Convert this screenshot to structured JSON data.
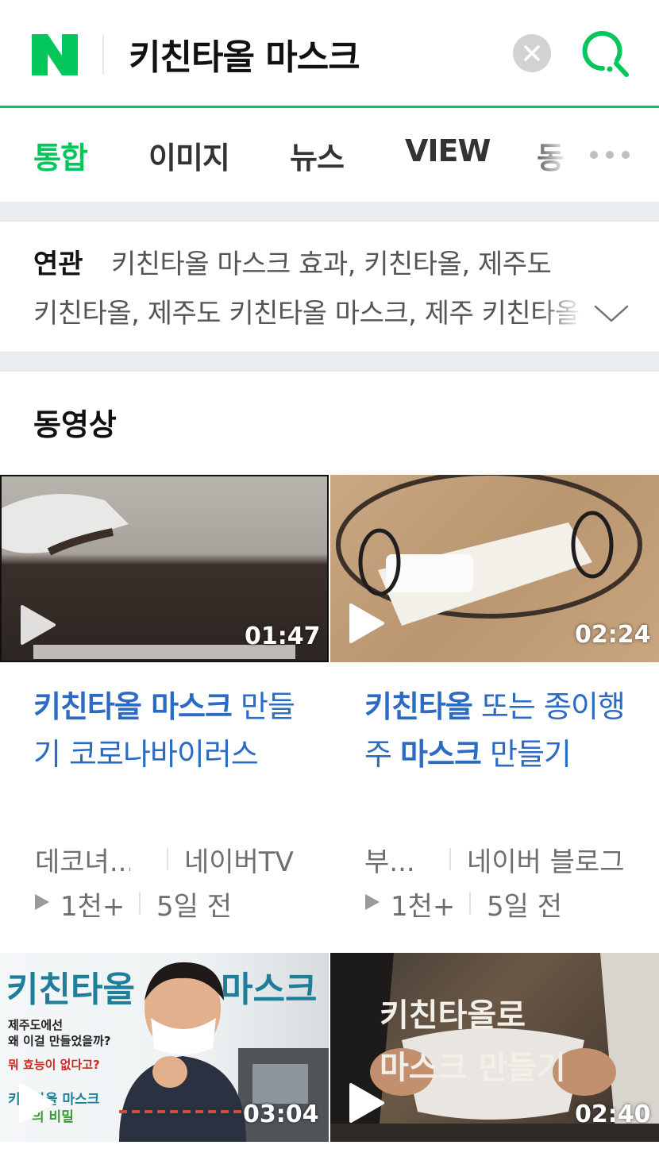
{
  "search": {
    "query": "키친타올 마스크"
  },
  "tabs": [
    {
      "label": "통합",
      "active": true
    },
    {
      "label": "이미지",
      "active": false
    },
    {
      "label": "뉴스",
      "active": false
    },
    {
      "label": "VIEW",
      "active": false
    },
    {
      "label": "동",
      "active": false
    }
  ],
  "related": {
    "label": "연관",
    "line1": "키친타올 마스크 효과, 키친타올, 제주도",
    "line2": "키친타올, 제주도 키친타올 마스크, 제주 키친타올"
  },
  "video_section": {
    "title": "동영상",
    "videos": [
      {
        "duration": "01:47",
        "title_parts": [
          {
            "text": "키친타올 마스크",
            "bold": true
          },
          {
            "text": " 만들기 코로나바이러스",
            "bold": false
          }
        ],
        "author": "데코녀...",
        "source": "네이버TV",
        "views": "1천+",
        "date": "5일 전"
      },
      {
        "duration": "02:24",
        "title_parts": [
          {
            "text": "키친타올",
            "bold": true
          },
          {
            "text": " 또는 종이행주 ",
            "bold": false
          },
          {
            "text": "마스크",
            "bold": true
          },
          {
            "text": " 만들기",
            "bold": false
          }
        ],
        "author": "부...",
        "source": "네이버 블로그",
        "views": "1천+",
        "date": "5일 전"
      },
      {
        "duration": "03:04",
        "thumb_text": {
          "left": "키친타올",
          "right": "마스크",
          "line1": "제주도에선",
          "line2": "왜 이걸 만들었을까?",
          "line3": "뭐 효능이 없다고?",
          "line4": "키친타올 마스크",
          "line5": "의 비밀"
        }
      },
      {
        "duration": "02:40",
        "thumb_text": {
          "line1": "키친타올로",
          "line2": "마스크 만들기"
        }
      }
    ]
  },
  "colors": {
    "brand": "#03c75a",
    "link": "#2b6bc4",
    "meta": "#6e6e6e"
  },
  "icons": [
    "naver-logo",
    "clear-icon",
    "search-icon",
    "more-icon",
    "chevron-down-icon",
    "play-icon"
  ]
}
